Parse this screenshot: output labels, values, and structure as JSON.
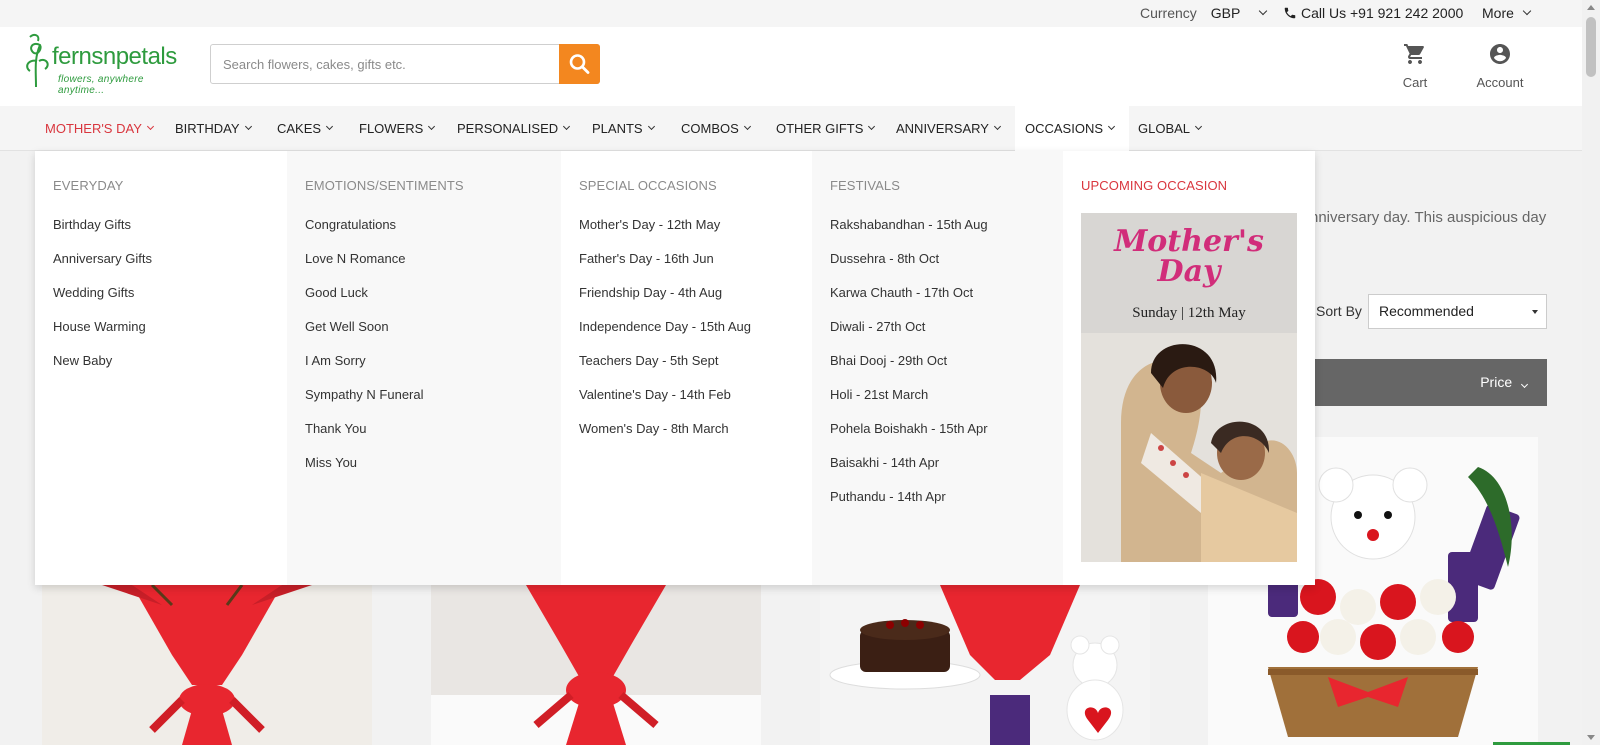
{
  "topbar": {
    "currency_label": "Currency",
    "currency_value": "GBP",
    "call_label": "Call Us +91 921 242 2000",
    "more_label": "More"
  },
  "header": {
    "logo_brand": "fernsnpetals",
    "logo_tagline": "flowers, anywhere anytime...",
    "search_placeholder": "Search flowers, cakes, gifts etc.",
    "cart_label": "Cart",
    "account_label": "Account"
  },
  "nav": {
    "items": [
      {
        "label": "MOTHER'S DAY"
      },
      {
        "label": "BIRTHDAY"
      },
      {
        "label": "CAKES"
      },
      {
        "label": "FLOWERS"
      },
      {
        "label": "PERSONALISED"
      },
      {
        "label": "PLANTS"
      },
      {
        "label": "COMBOS"
      },
      {
        "label": "OTHER GIFTS"
      },
      {
        "label": "ANNIVERSARY"
      },
      {
        "label": "OCCASIONS"
      },
      {
        "label": "GLOBAL"
      }
    ],
    "highlight_color": "#d9363e"
  },
  "dropdown": {
    "columns": [
      {
        "heading": "EVERYDAY",
        "items": [
          "Birthday Gifts",
          "Anniversary Gifts",
          "Wedding Gifts",
          "House Warming",
          "New Baby"
        ]
      },
      {
        "heading": "EMOTIONS/SENTIMENTS",
        "items": [
          "Congratulations",
          "Love N Romance",
          "Good Luck",
          "Get Well Soon",
          "I Am Sorry",
          "Sympathy N Funeral",
          "Thank You",
          "Miss You"
        ]
      },
      {
        "heading": "SPECIAL OCCASIONS",
        "items": [
          "Mother's Day - 12th May",
          "Father's Day - 16th Jun",
          "Friendship Day - 4th Aug",
          "Independence Day - 15th Aug",
          "Teachers Day - 5th Sept",
          "Valentine's Day - 14th Feb",
          "Women's Day - 8th March"
        ]
      },
      {
        "heading": "FESTIVALS",
        "items": [
          "Rakshabandhan - 15th Aug",
          "Dussehra - 8th Oct",
          "Karwa Chauth - 17th Oct",
          "Diwali - 27th Oct",
          "Bhai Dooj - 29th Oct",
          "Holi - 21st March",
          "Pohela Boishakh - 15th Apr",
          "Baisakhi - 14th Apr",
          "Puthandu - 14th Apr"
        ]
      }
    ],
    "upcoming": {
      "heading": "UPCOMING OCCASION",
      "promo_title": "Mother's Day",
      "promo_date": "Sunday | 12th May"
    }
  },
  "page": {
    "intro_fragment": "nniversary day. This auspicious day",
    "sort_label": "Sort By",
    "sort_value": "Recommended",
    "filter_price_label": "Price"
  },
  "colors": {
    "accent_orange": "#f3871f",
    "brand_green": "#2e9b3e",
    "red": "#d9363e"
  }
}
